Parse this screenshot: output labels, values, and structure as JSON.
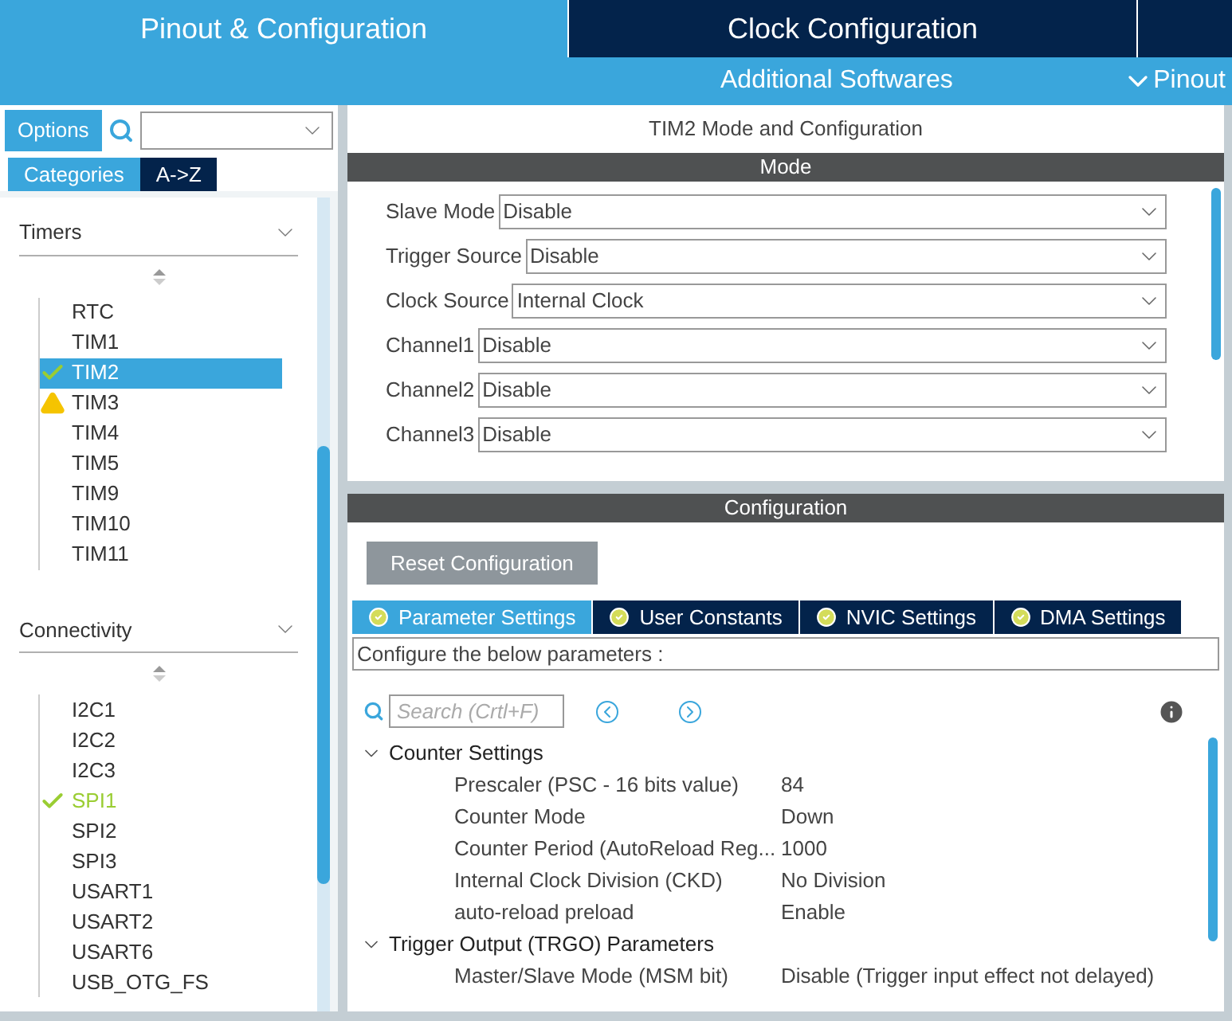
{
  "top_tabs": [
    {
      "label": "Pinout & Configuration",
      "selected": true
    },
    {
      "label": "Clock Configuration",
      "selected": false
    }
  ],
  "sub_bar": {
    "additional": "Additional Softwares",
    "pinout": "Pinout"
  },
  "left": {
    "options": "Options",
    "view_tabs": [
      {
        "label": "Categories",
        "selected": true
      },
      {
        "label": "A->Z",
        "selected": false
      }
    ],
    "categories": [
      {
        "title": "Timers",
        "items": [
          {
            "label": "RTC",
            "configured": false,
            "warning": false,
            "selected": false
          },
          {
            "label": "TIM1",
            "configured": false,
            "warning": false,
            "selected": false
          },
          {
            "label": "TIM2",
            "configured": true,
            "warning": false,
            "selected": true
          },
          {
            "label": "TIM3",
            "configured": false,
            "warning": true,
            "selected": false
          },
          {
            "label": "TIM4",
            "configured": false,
            "warning": false,
            "selected": false
          },
          {
            "label": "TIM5",
            "configured": false,
            "warning": false,
            "selected": false
          },
          {
            "label": "TIM9",
            "configured": false,
            "warning": false,
            "selected": false
          },
          {
            "label": "TIM10",
            "configured": false,
            "warning": false,
            "selected": false
          },
          {
            "label": "TIM11",
            "configured": false,
            "warning": false,
            "selected": false
          }
        ]
      },
      {
        "title": "Connectivity",
        "items": [
          {
            "label": "I2C1",
            "configured": false,
            "warning": false,
            "selected": false
          },
          {
            "label": "I2C2",
            "configured": false,
            "warning": false,
            "selected": false
          },
          {
            "label": "I2C3",
            "configured": false,
            "warning": false,
            "selected": false
          },
          {
            "label": "SPI1",
            "configured": true,
            "warning": false,
            "selected": false
          },
          {
            "label": "SPI2",
            "configured": false,
            "warning": false,
            "selected": false
          },
          {
            "label": "SPI3",
            "configured": false,
            "warning": false,
            "selected": false
          },
          {
            "label": "USART1",
            "configured": false,
            "warning": false,
            "selected": false
          },
          {
            "label": "USART2",
            "configured": false,
            "warning": false,
            "selected": false
          },
          {
            "label": "USART6",
            "configured": false,
            "warning": false,
            "selected": false
          },
          {
            "label": "USB_OTG_FS",
            "configured": false,
            "warning": false,
            "selected": false
          }
        ]
      }
    ]
  },
  "panel": {
    "title": "TIM2 Mode and Configuration",
    "mode_header": "Mode",
    "mode_fields": [
      {
        "label": "Slave Mode",
        "value": "Disable"
      },
      {
        "label": "Trigger Source",
        "value": "Disable"
      },
      {
        "label": "Clock Source",
        "value": "Internal Clock"
      },
      {
        "label": "Channel1",
        "value": "Disable"
      },
      {
        "label": "Channel2",
        "value": "Disable"
      },
      {
        "label": "Channel3",
        "value": "Disable"
      }
    ],
    "config_header": "Configuration",
    "reset": "Reset Configuration",
    "config_tabs": [
      {
        "label": "Parameter Settings",
        "selected": true
      },
      {
        "label": "User Constants",
        "selected": false
      },
      {
        "label": "NVIC Settings",
        "selected": false
      },
      {
        "label": "DMA Settings",
        "selected": false
      }
    ],
    "hint": "Configure the below parameters :",
    "search_placeholder": "Search (Crtl+F)",
    "groups": [
      {
        "title": "Counter Settings",
        "expanded": true,
        "params": [
          {
            "name": "Prescaler (PSC - 16 bits value)",
            "value": "84"
          },
          {
            "name": "Counter Mode",
            "value": "Down"
          },
          {
            "name": "Counter Period (AutoReload Reg...",
            "value": "1000"
          },
          {
            "name": "Internal Clock Division (CKD)",
            "value": "No Division"
          },
          {
            "name": "auto-reload preload",
            "value": "Enable"
          }
        ]
      },
      {
        "title": "Trigger Output (TRGO) Parameters",
        "expanded": true,
        "params": [
          {
            "name": "Master/Slave Mode (MSM bit)",
            "value": "Disable (Trigger input effect not delayed)"
          }
        ]
      }
    ]
  }
}
